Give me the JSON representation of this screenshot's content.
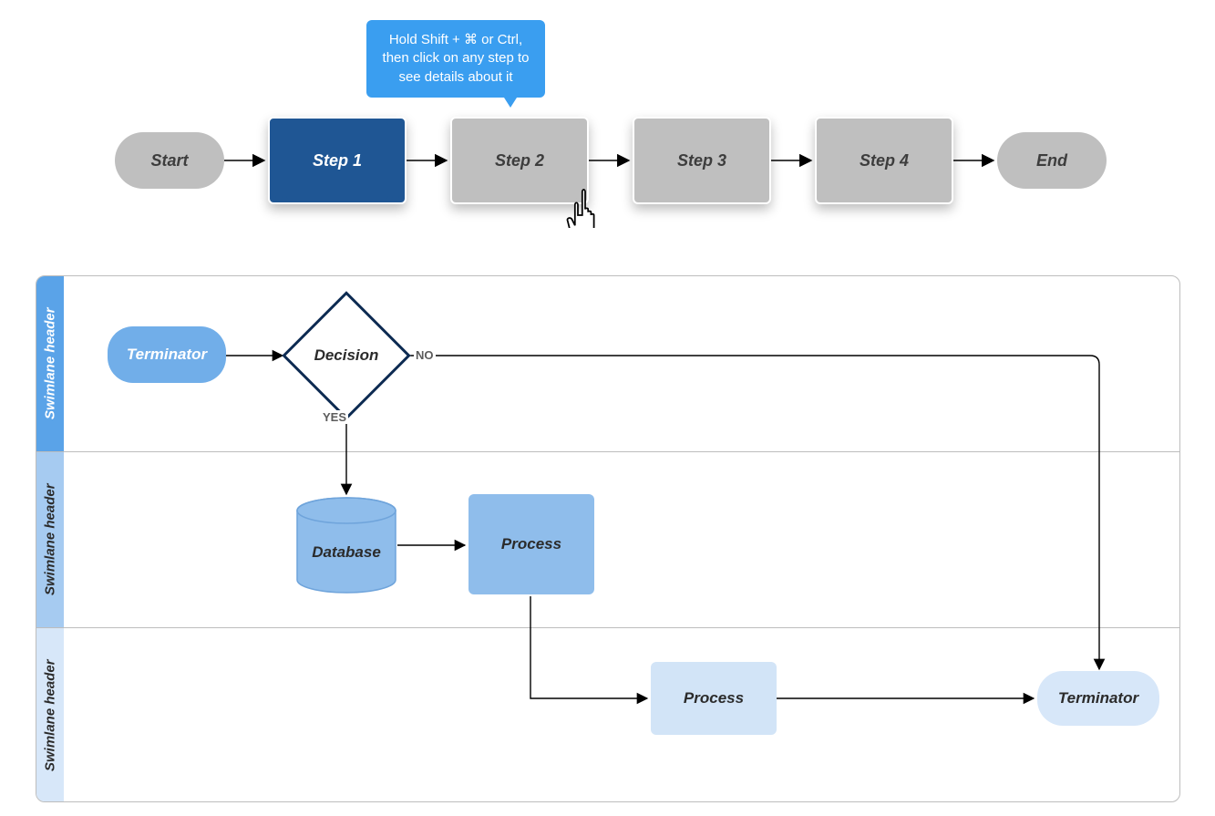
{
  "tooltip": {
    "text": "Hold Shift + ⌘ or Ctrl, then click on any step to see details about it"
  },
  "flow": {
    "start": "Start",
    "end": "End",
    "steps": [
      "Step 1",
      "Step 2",
      "Step 3",
      "Step 4"
    ]
  },
  "swimlanes": {
    "headers": [
      "Swimlane header",
      "Swimlane header",
      "Swimlane header"
    ],
    "lane1": {
      "terminator": "Terminator",
      "decision": "Decision",
      "decision_yes": "YES",
      "decision_no": "NO"
    },
    "lane2": {
      "database": "Database",
      "process": "Process"
    },
    "lane3": {
      "process": "Process",
      "terminator": "Terminator"
    }
  },
  "colors": {
    "step_grey": "#bfbfbf",
    "step_blue": "#1f5694",
    "tooltip_blue": "#3a9ef0",
    "lane1_header": "#5aa3e8",
    "lane2_header": "#a6cbf1",
    "lane3_header": "#d7e7f9",
    "decision_border": "#0d2b52"
  }
}
